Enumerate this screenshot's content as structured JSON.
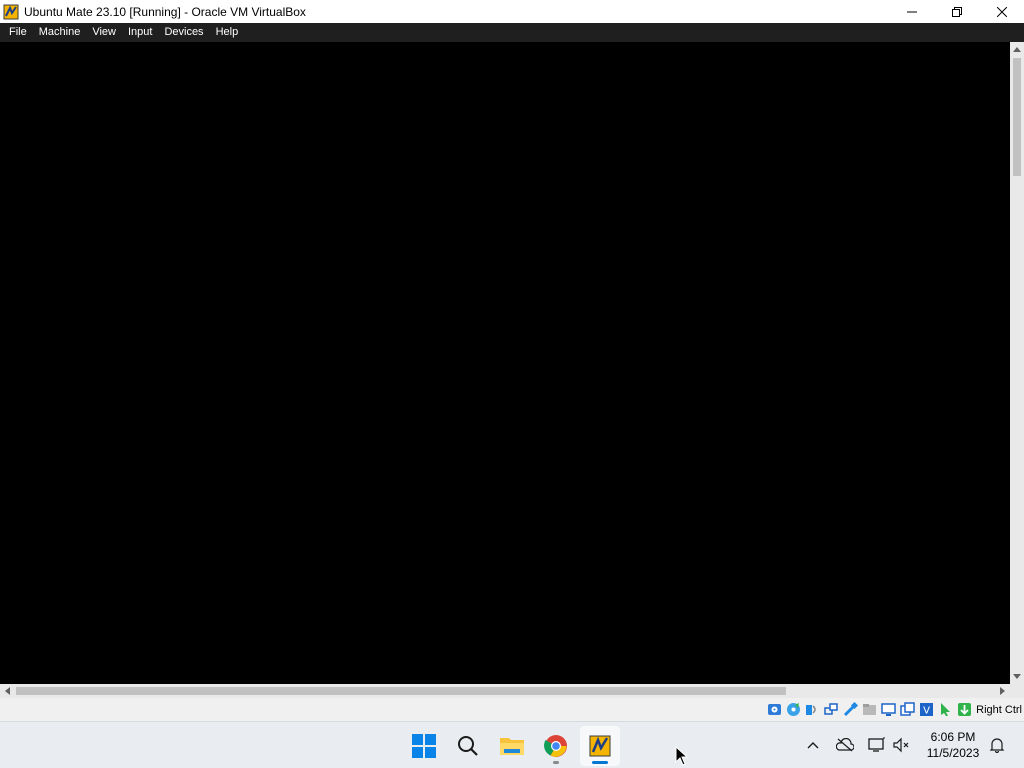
{
  "window": {
    "title": "Ubuntu Mate 23.10 [Running] - Oracle VM VirtualBox",
    "icon": "virtualbox-icon",
    "controls": [
      "minimize-icon",
      "maximize-icon",
      "close-icon"
    ]
  },
  "menubar": {
    "items": [
      {
        "label": "File"
      },
      {
        "label": "Machine"
      },
      {
        "label": "View"
      },
      {
        "label": "Input"
      },
      {
        "label": "Devices"
      },
      {
        "label": "Help"
      }
    ]
  },
  "statusbar": {
    "icons": [
      "hard-disk-icon",
      "optical-drive-icon",
      "audio-icon",
      "network-icon",
      "usb-icon",
      "shared-folders-icon",
      "display-icon",
      "recording-icon",
      "vt-x-icon",
      "mouse-integration-icon",
      "keyboard-capture-icon"
    ],
    "host_key": "Right Ctrl"
  },
  "taskbar": {
    "apps": [
      "windows-start-icon",
      "search-icon",
      "file-explorer-icon",
      "chrome-icon",
      "virtualbox-icon"
    ],
    "tray": [
      "show-hidden-icons-chevron",
      "onedrive-icon",
      "network-icon",
      "volume-muted-icon"
    ],
    "time": "6:06 PM",
    "date": "11/5/2023",
    "notifications": "bell-icon"
  },
  "colors": {
    "menubar_bg": "#1f1f1f",
    "vm_screen": "#000000",
    "taskbar_bg": "#e9ecf1",
    "accent": "#0078d4"
  }
}
